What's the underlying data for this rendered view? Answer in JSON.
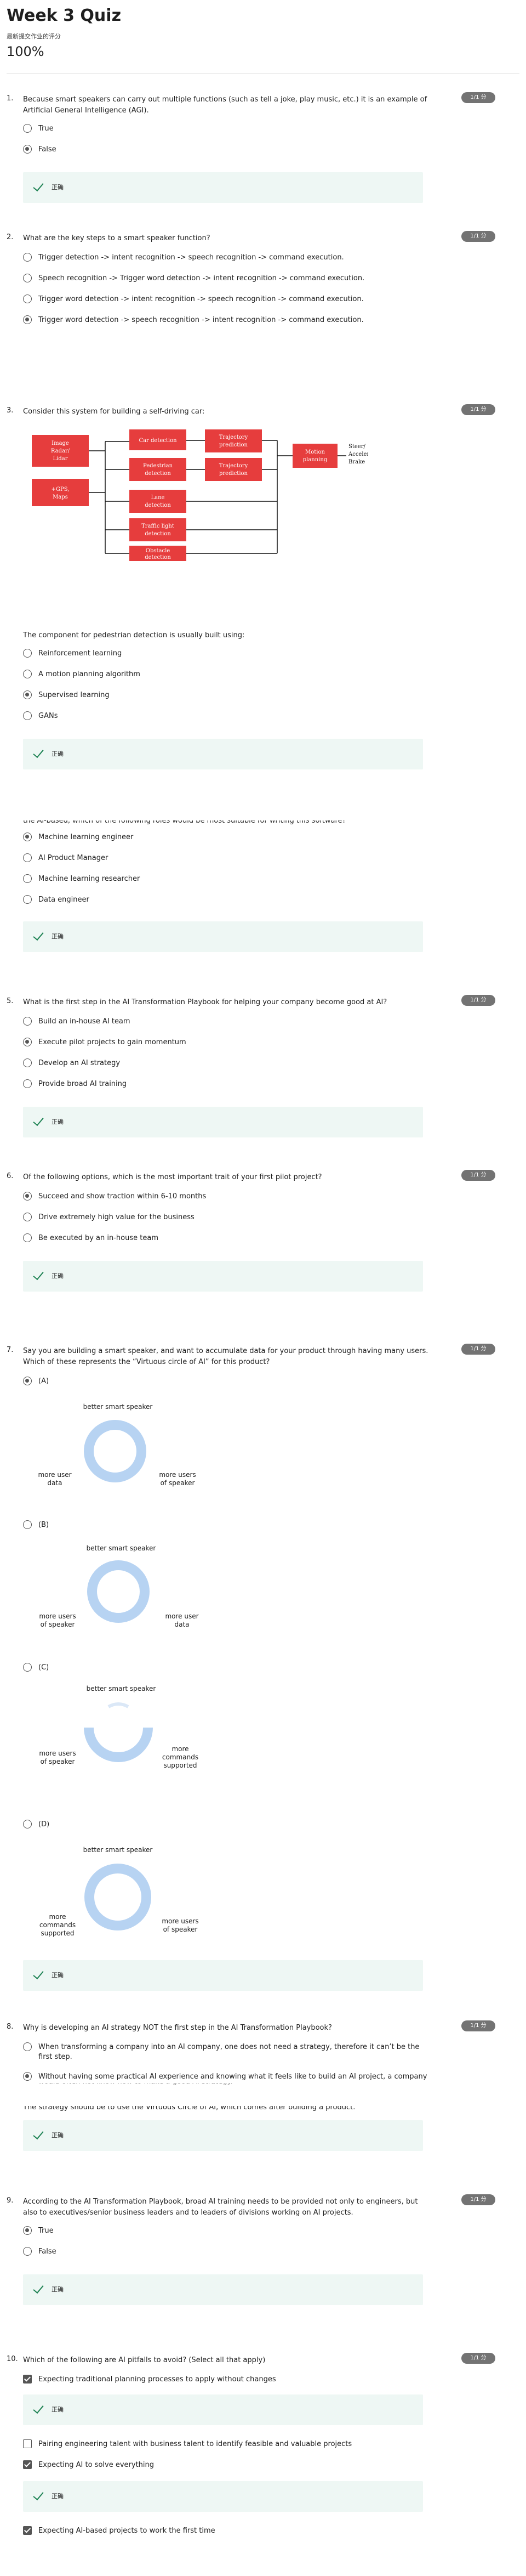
{
  "header": {
    "title": "Week 3 Quiz",
    "score_label": "最新提交作业的评分",
    "score_value": "100%"
  },
  "feedback_label": "正确",
  "questions": [
    {
      "num": "1.",
      "text": "Because smart speakers can carry out multiple functions (such as tell a joke, play music, etc.) it is an example of Artificial General Intelligence (AGI).",
      "points": "1/1 分",
      "options": [
        "True",
        "False"
      ],
      "selected": 1
    },
    {
      "num": "2.",
      "text": "What are the key steps to a smart speaker function?",
      "points": "1/1 分",
      "options": [
        "Trigger detection -> intent recognition -> speech recognition -> command execution.",
        "Speech recognition -> Trigger word detection -> intent recognition -> command execution.",
        "Trigger word detection -> intent recognition -> speech recognition -> command execution.",
        "Trigger word detection -> speech recognition -> intent recognition -> command execution."
      ],
      "selected": 3
    },
    {
      "num": "3.",
      "text": "Consider this system for building a self-driving car:",
      "points": "1/1 分",
      "question2": "The component for pedestrian detection is usually built using:",
      "options": [
        "Reinforcement learning",
        "A motion planning algorithm",
        "Supervised learning",
        "GANs"
      ],
      "selected": 2,
      "diagram": {
        "inputs": [
          "Image Radar/ Lidar",
          "+GPS, Maps"
        ],
        "detectors": [
          "Car detection",
          "Pedestrian detection",
          "Lane detection",
          "Traffic light detection",
          "Obstacle detection"
        ],
        "predictions": [
          "Trajectory prediction",
          "Trajectory prediction"
        ],
        "planner": "Motion planning",
        "outputs": [
          "Steer/",
          "Accelerate/",
          "Brake"
        ]
      }
    },
    {
      "num": "4.",
      "cut_text": "the Ai-based, which of the following roles would be most suitable for writing this software?",
      "options": [
        "Machine learning engineer",
        "AI Product Manager",
        "Machine learning researcher",
        "Data engineer"
      ],
      "selected": 0
    },
    {
      "num": "5.",
      "text": "What is the first step in the AI Transformation Playbook for helping your company become good at AI?",
      "points": "1/1 分",
      "options": [
        "Build an in-house AI team",
        "Execute pilot projects to gain momentum",
        "Develop an AI strategy",
        "Provide broad AI training"
      ],
      "selected": 1
    },
    {
      "num": "6.",
      "text": "Of the following options, which is the most important trait of your first pilot project?",
      "points": "1/1 分",
      "options": [
        "Succeed and show traction within 6-10 months",
        "Drive extremely high value for the business",
        "Be executed by an in-house team"
      ],
      "selected": 0
    },
    {
      "num": "7.",
      "text": "Say you are building a smart speaker, and want to accumulate data for your product through having many users. Which of these represents the “Virtuous circle of AI” for this product?",
      "points": "1/1 分",
      "options": [
        "(A)",
        "(B)",
        "(C)",
        "(D)"
      ],
      "selected": 0,
      "cycles": [
        {
          "top": "better smart speaker",
          "left": "more user\ndata",
          "right": "more users\nof speaker"
        },
        {
          "top": "better smart speaker",
          "left": "more users\nof speaker",
          "right": "more user\ndata"
        },
        {
          "top": "better smart speaker",
          "left": "more users\nof speaker",
          "right": "more\ncommands\nsupported"
        },
        {
          "top": "better smart speaker",
          "left": "more\ncommands\nsupported",
          "right": "more users\nof speaker"
        }
      ]
    },
    {
      "num": "8.",
      "text": "Why is developing an AI strategy NOT the first step in the AI Transformation Playbook?",
      "points": "1/1 分",
      "options": [
        "When transforming a company into an AI company, one does not need a strategy, therefore it can’t be the first step.",
        "Without having some practical AI experience and knowing what it feels like to build an AI project, a company"
      ],
      "cut_option": "The strategy should be to use the Virtuous Circle of AI, which comes after building a product.",
      "selected": 1
    },
    {
      "num": "9.",
      "text": "According to the AI Transformation Playbook, broad AI training needs to be provided not only to engineers, but also to executives/senior business leaders and to leaders of divisions working on AI projects.",
      "points": "1/1 分",
      "options": [
        "True",
        "False"
      ],
      "selected": 0
    },
    {
      "num": "10.",
      "text": "Which of the following are AI pitfalls to avoid? (Select all that apply)",
      "points": "1/1 分",
      "options": [
        "Expecting traditional planning processes to apply without changes",
        "Pairing engineering talent with business talent to identify feasible and valuable projects",
        "Expecting AI to solve everything",
        "Expecting AI-based projects to work the first time"
      ],
      "checked": [
        true,
        false,
        true,
        true
      ]
    }
  ]
}
